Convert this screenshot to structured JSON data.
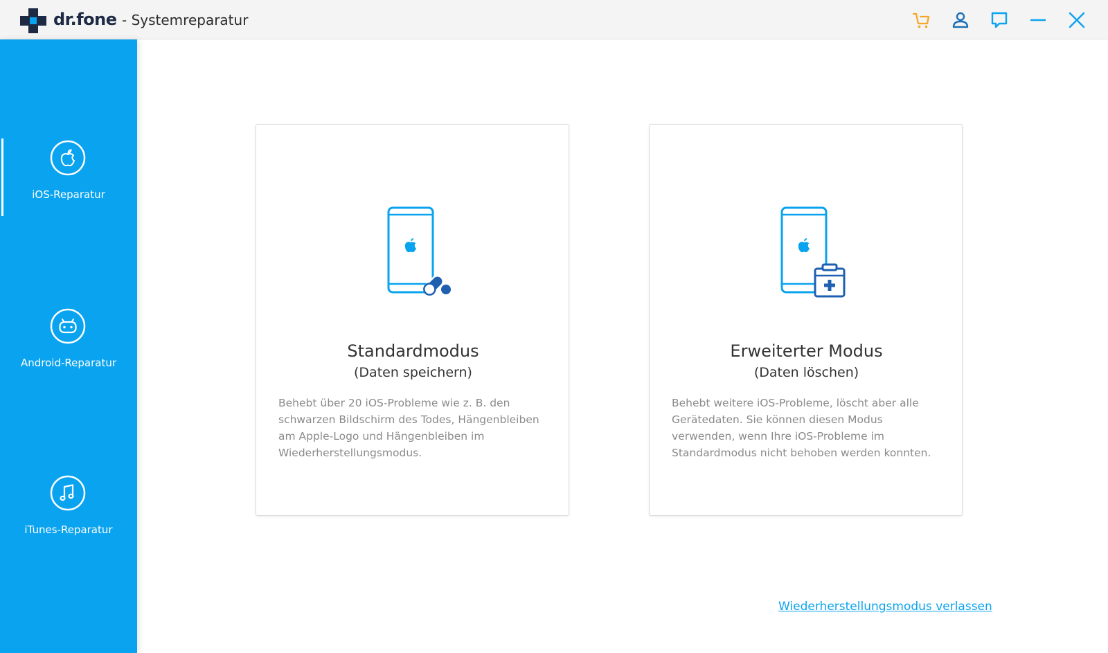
{
  "app": {
    "brand": "dr.fone",
    "subtitle": "- Systemreparatur"
  },
  "titlebar": {
    "icons": [
      "cart-icon",
      "user-icon",
      "feedback-icon",
      "minimize-icon",
      "close-icon"
    ],
    "accent_cart": "#f5a623",
    "accent_blue": "#0aa3ef"
  },
  "sidebar": {
    "color": "#0aa3ef",
    "items": [
      {
        "label": "iOS-Reparatur",
        "icon": "apple-icon",
        "active": true
      },
      {
        "label": "Android-Reparatur",
        "icon": "android-icon",
        "active": false
      },
      {
        "label": "iTunes-Reparatur",
        "icon": "music-note-icon",
        "active": false
      }
    ]
  },
  "main": {
    "cards": [
      {
        "title": "Standardmodus",
        "subtitle": "(Daten speichern)",
        "description": "Behebt über 20 iOS-Probleme wie z. B. den schwarzen Bildschirm des Todes, Hängenbleiben am Apple-Logo und Hängenbleiben im Wiederherstellungsmodus.",
        "icon": "phone-pill-icon"
      },
      {
        "title": "Erweiterter Modus",
        "subtitle": "(Daten löschen)",
        "description": "Behebt weitere iOS-Probleme, löscht aber alle Gerätedaten. Sie können diesen Modus verwenden, wenn Ihre iOS-Probleme im Standardmodus nicht behoben werden konnten.",
        "icon": "phone-medkit-icon"
      }
    ],
    "exit_link": "Wiederherstellungsmodus verlassen"
  }
}
